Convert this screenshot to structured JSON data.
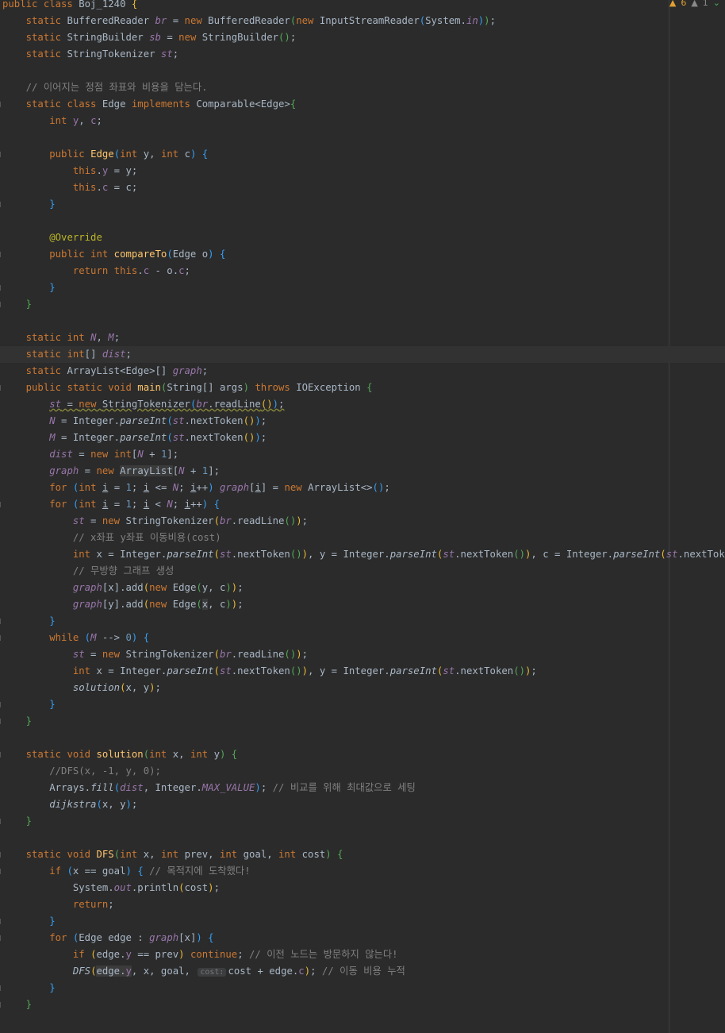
{
  "status": {
    "warnings": "6",
    "weak_warnings": "1",
    "warning_icon": "warning-triangle-icon",
    "weak_icon": "weak-warning-triangle-icon",
    "check_icon": "chevron-check-icon"
  },
  "parameter_hint": "cost:",
  "comments": {
    "edge": "// 이어지는 정점 좌표와 비용을 담는다.",
    "xy_cost": "// x좌표 y좌표 이동비용(cost)",
    "undirected": "// 무방향 그래프 생성",
    "dfs_call": "//DFS(x, -1, y, 0);",
    "fill": "// 비교를 위해 최대값으로 세팅",
    "arrived": "// 목적지에 도착했다!",
    "no_revisit": "// 이전 노드는 방문하지 않는다!",
    "accumulate": "// 이동 비용 누적"
  },
  "colors": {
    "background": "#2b2b2b",
    "keyword": "#cc7832",
    "comment": "#808080",
    "number": "#6897bb",
    "method": "#ffc66d",
    "field": "#9876aa",
    "text": "#a9b7c6"
  }
}
